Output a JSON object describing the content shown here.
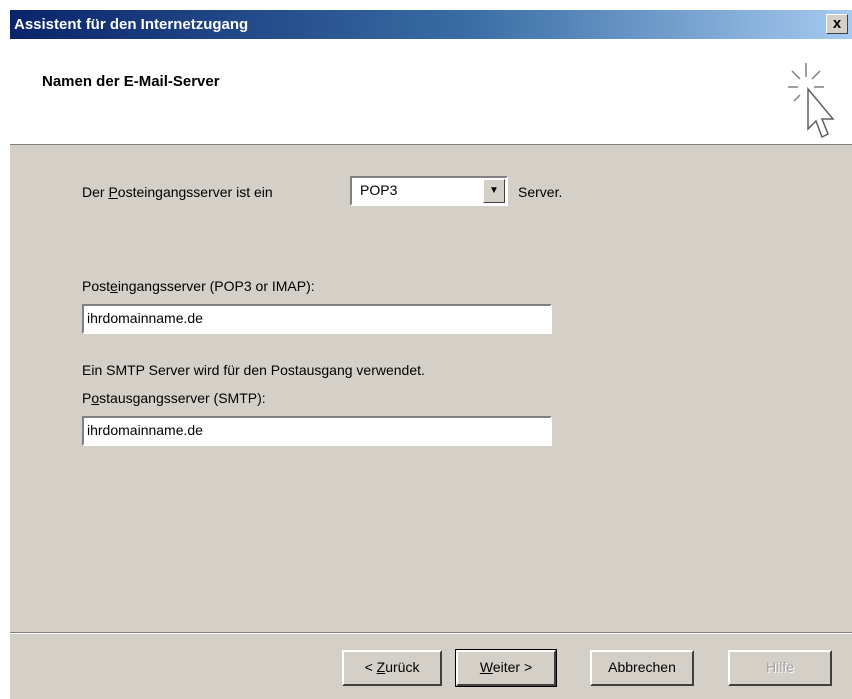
{
  "window": {
    "title": "Assistent für den Internetzugang",
    "close_label": "x"
  },
  "header": {
    "title": "Namen der E-Mail-Server",
    "icon": "wizard-cursor-icon"
  },
  "incoming_type": {
    "label_prefix": "Der ",
    "label_accel": "P",
    "label_rest": "osteingangsserver ist ein",
    "selected": "POP3",
    "suffix": "Server."
  },
  "incoming_server": {
    "label_pre": "Post",
    "label_accel": "e",
    "label_rest": "ingangsserver (POP3 or IMAP):",
    "value": "ihrdomainname.de"
  },
  "smtp_note": "Ein SMTP Server wird für den Postausgang verwendet.",
  "outgoing_server": {
    "label_pre": "P",
    "label_accel": "o",
    "label_rest": "stausgangsserver (SMTP):",
    "value": "ihrdomainname.de"
  },
  "buttons": {
    "back": {
      "pre": "< ",
      "accel": "Z",
      "rest": "urück"
    },
    "next": {
      "accel": "W",
      "rest": "eiter >"
    },
    "cancel": "Abbrechen",
    "help": "Hilfe"
  }
}
